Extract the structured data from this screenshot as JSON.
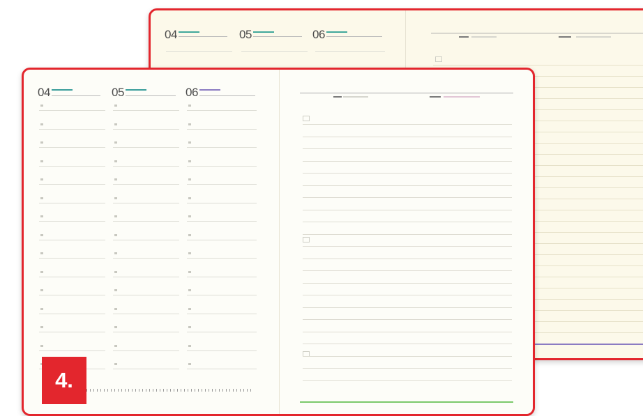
{
  "planners": [
    {
      "days": [
        {
          "number": "04",
          "accent": "#3fa89b"
        },
        {
          "number": "05",
          "accent": "#3fa89b"
        },
        {
          "number": "06",
          "accent": "#3fa89b"
        }
      ]
    },
    {
      "days": [
        {
          "number": "04",
          "accent": "#3a9d9b"
        },
        {
          "number": "05",
          "accent": "#3a9d9b"
        },
        {
          "number": "06",
          "accent": "#8b7bc2"
        }
      ]
    }
  ],
  "badge": {
    "label": "4."
  },
  "colors": {
    "frame": "#e3262d",
    "page": "#fdfdf8",
    "back_page": "#fcf9ea",
    "notes_green": "#7bc96a",
    "notes_purple": "#8b7bc2"
  }
}
